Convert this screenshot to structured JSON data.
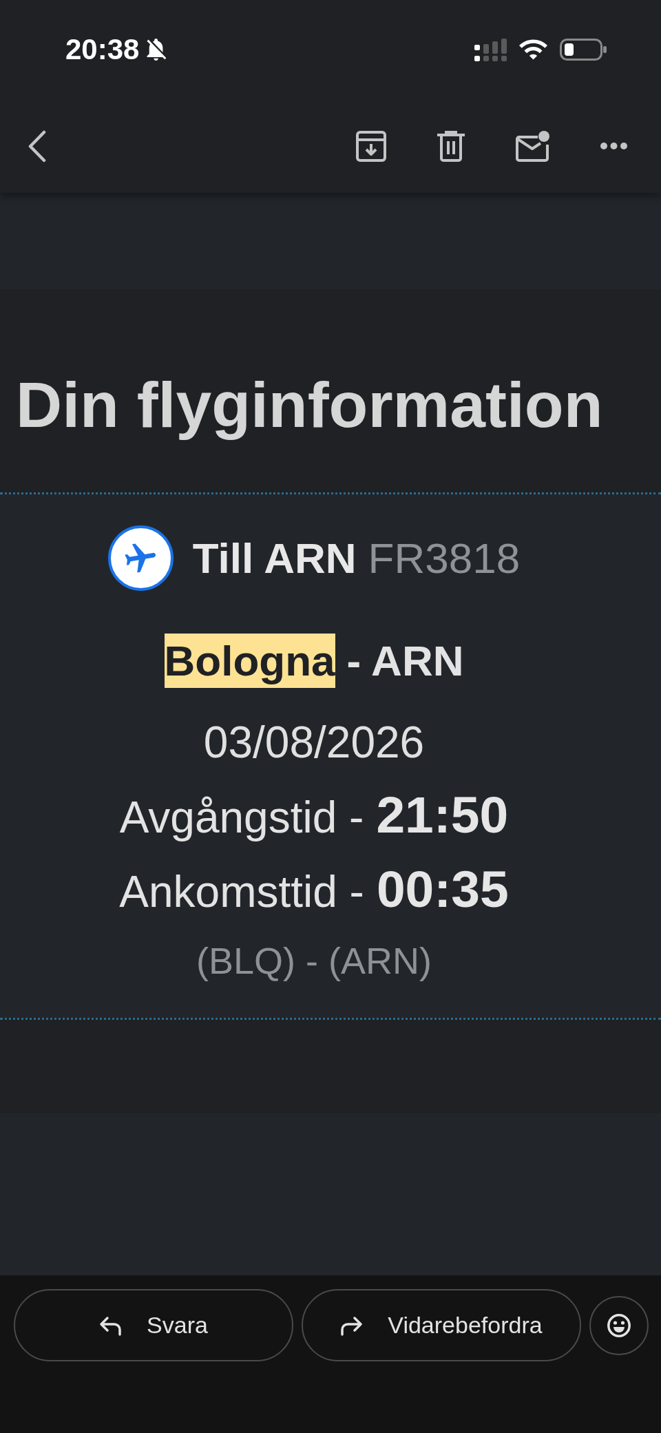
{
  "status_bar": {
    "time": "20:38",
    "silent": true
  },
  "email": {
    "title": "Din flyginformation",
    "flight": {
      "destination": "Till ARN",
      "flight_number": "FR3818",
      "route": [
        {
          "text": "Bologna",
          "highlighted": true
        },
        {
          "text": "- ARN",
          "highlighted": false
        }
      ],
      "date": "03/08/2026",
      "times": [
        {
          "label": "Avgångstid -",
          "value": "21:50"
        },
        {
          "label": "Ankomsttid -",
          "value": "00:35"
        }
      ],
      "airports": "(BLQ) - (ARN)"
    }
  },
  "actions": [
    {
      "kind": "reply",
      "label": "Svara"
    },
    {
      "kind": "forward",
      "label": "Vidarebefordra"
    },
    {
      "kind": "react"
    }
  ]
}
